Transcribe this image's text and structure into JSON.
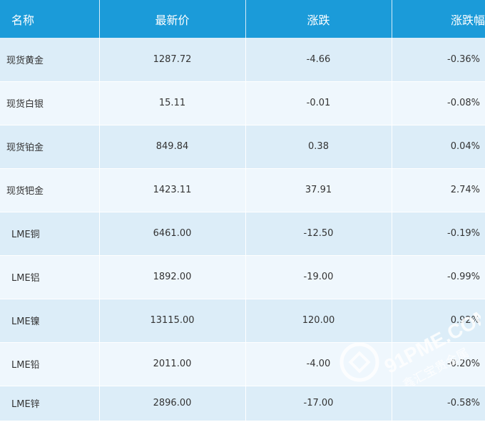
{
  "table": {
    "headers": [
      "名称",
      "最新价",
      "涨跌",
      "涨跌幅"
    ],
    "rows": [
      {
        "name": "现货黄金",
        "price": "1287.72",
        "change": "-4.66",
        "pct": "-0.36%"
      },
      {
        "name": "现货白银",
        "price": "15.11",
        "change": "-0.01",
        "pct": "-0.08%"
      },
      {
        "name": "现货铂金",
        "price": "849.84",
        "change": "0.38",
        "pct": "0.04%"
      },
      {
        "name": "现货钯金",
        "price": "1423.11",
        "change": "37.91",
        "pct": "2.74%"
      },
      {
        "name": "LME铜",
        "price": "6461.00",
        "change": "-12.50",
        "pct": "-0.19%"
      },
      {
        "name": "LME铝",
        "price": "1892.00",
        "change": "-19.00",
        "pct": "-0.99%"
      },
      {
        "name": "LME镍",
        "price": "13115.00",
        "change": "120.00",
        "pct": "0.92%"
      },
      {
        "name": "LME铅",
        "price": "2011.00",
        "change": "-4.00",
        "pct": "-0.20%"
      },
      {
        "name": "LME锌",
        "price": "2896.00",
        "change": "-17.00",
        "pct": "-0.58%"
      }
    ]
  },
  "watermark": {
    "domain": "91PME.COM",
    "subtitle": "鑫汇宝贵金属"
  },
  "colors": {
    "header_bg": "#1b9bd9",
    "row_odd": "#dcedf8",
    "row_even": "#eff7fd"
  }
}
